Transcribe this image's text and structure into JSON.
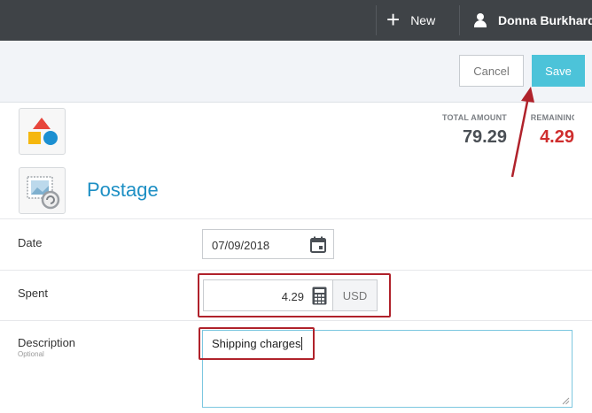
{
  "topbar": {
    "new_label": "New",
    "user_name": "Donna Burkhardt",
    "icons": [
      "plus-icon",
      "user-icon"
    ]
  },
  "actions": {
    "cancel_label": "Cancel",
    "save_label": "Save",
    "save_color": "#4cc3d9"
  },
  "expense": {
    "title": "Postage",
    "category_icon": "shapes-icon",
    "receipt_icon": "stamp-icon"
  },
  "totals": {
    "total_label": "TOTAL AMOUNT",
    "total_value": "79.29",
    "remaining_label": "REMAINING",
    "remaining_value": "4.29",
    "remaining_color": "#cf2e2e"
  },
  "form": {
    "date": {
      "label": "Date",
      "value": "07/09/2018",
      "icon": "calendar-icon"
    },
    "spent": {
      "label": "Spent",
      "value": "4.29",
      "currency": "USD",
      "icon": "calculator-icon"
    },
    "description": {
      "label": "Description",
      "sublabel": "Optional",
      "value": "Shipping charges"
    }
  },
  "annotation": {
    "highlight_color": "#b0222b"
  }
}
